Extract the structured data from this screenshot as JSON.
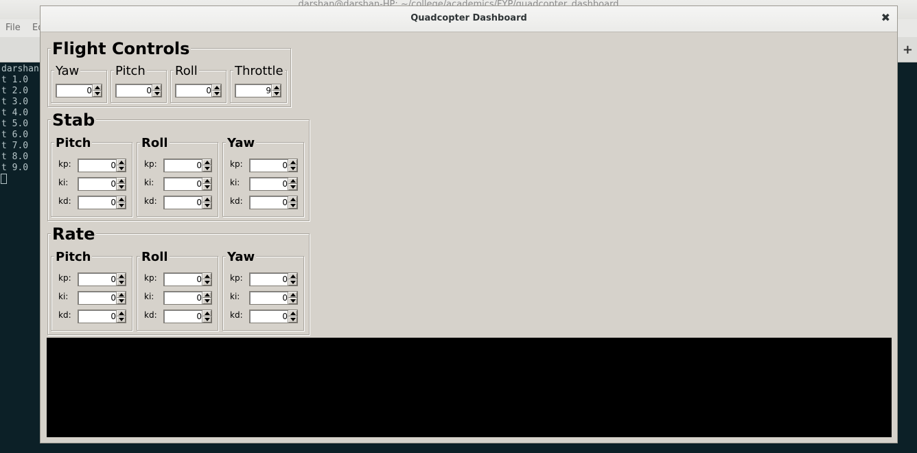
{
  "background": {
    "title": "darshan@darshan-HP: ~/college/academics/FYP/quadcopter_dashboard",
    "menu": [
      "File",
      "Ed"
    ],
    "tab_add": "+",
    "terminal_lines": [
      "darshan",
      "t 1.0",
      "t 2.0",
      "t 3.0",
      "t 4.0",
      "t 5.0",
      "t 6.0",
      "t 7.0",
      "t 8.0",
      "t 9.0"
    ]
  },
  "window": {
    "title": "Quadcopter Dashboard",
    "close": "✖"
  },
  "flight_controls": {
    "title": "Flight Controls",
    "yaw": {
      "label": "Yaw",
      "value": "0"
    },
    "pitch": {
      "label": "Pitch",
      "value": "0"
    },
    "roll": {
      "label": "Roll",
      "value": "0"
    },
    "throttle": {
      "label": "Throttle",
      "value": "9"
    }
  },
  "stab": {
    "title": "Stab",
    "pitch": {
      "label": "Pitch",
      "kp": "0",
      "ki": "0",
      "kd": "0"
    },
    "roll": {
      "label": "Roll",
      "kp": "0",
      "ki": "0",
      "kd": "0"
    },
    "yaw": {
      "label": "Yaw",
      "kp": "0",
      "ki": "0",
      "kd": "0"
    }
  },
  "rate": {
    "title": "Rate",
    "pitch": {
      "label": "Pitch",
      "kp": "0",
      "ki": "0",
      "kd": "0"
    },
    "roll": {
      "label": "Roll",
      "kp": "0",
      "ki": "0",
      "kd": "0"
    },
    "yaw": {
      "label": "Yaw",
      "kp": "0",
      "ki": "0",
      "kd": "0"
    }
  },
  "gain_labels": {
    "kp": "kp:",
    "ki": "ki:",
    "kd": "kd:"
  },
  "console": {
    "text": ""
  }
}
